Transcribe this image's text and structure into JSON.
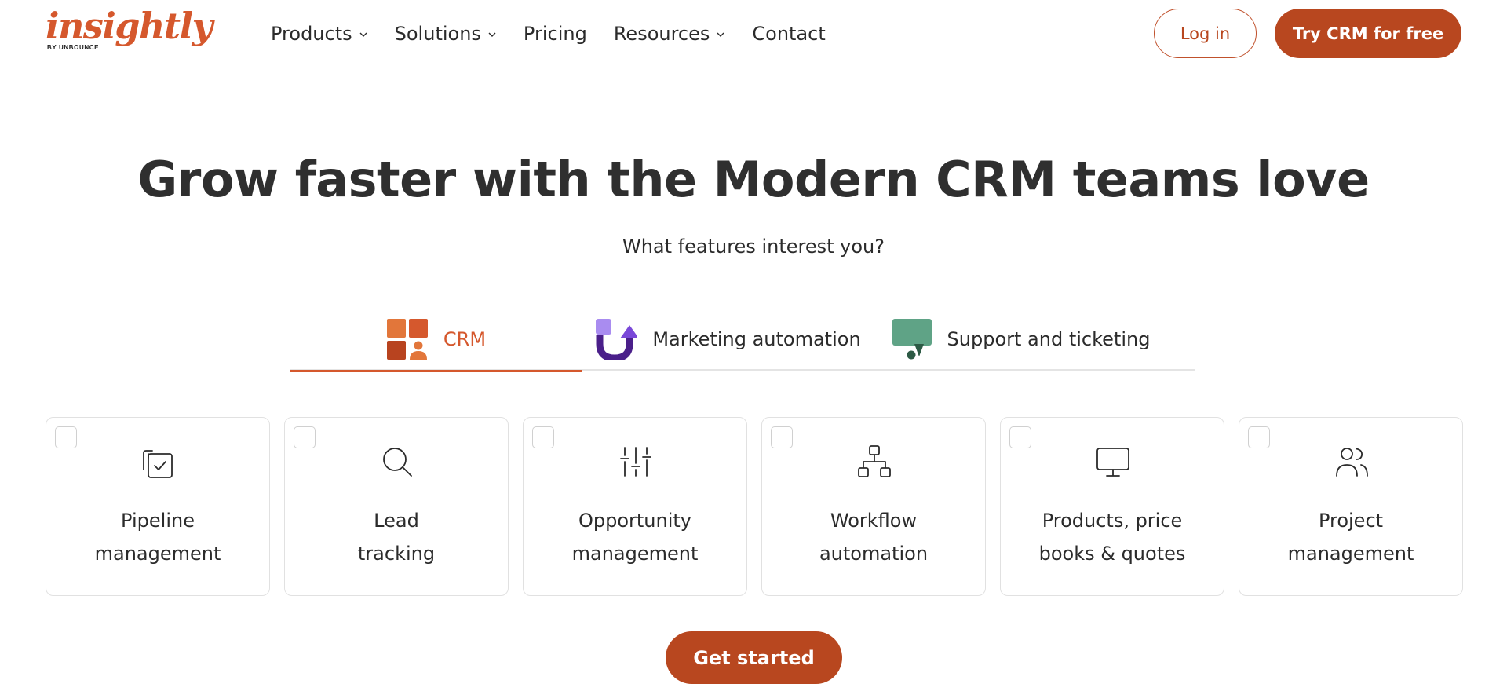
{
  "logo": {
    "name": "insightly",
    "byline": "BY UNBOUNCE"
  },
  "nav": {
    "items": [
      {
        "label": "Products",
        "has_dropdown": true
      },
      {
        "label": "Solutions",
        "has_dropdown": true
      },
      {
        "label": "Pricing",
        "has_dropdown": false
      },
      {
        "label": "Resources",
        "has_dropdown": true
      },
      {
        "label": "Contact",
        "has_dropdown": false
      }
    ],
    "login_label": "Log in",
    "trial_label": "Try CRM for free"
  },
  "hero": {
    "title": "Grow faster with the Modern CRM teams love",
    "subtitle": "What features interest you?"
  },
  "tabs": [
    {
      "label": "CRM",
      "icon": "crm-blocks-icon",
      "active": true
    },
    {
      "label": "Marketing automation",
      "icon": "marketing-arrow-icon",
      "active": false
    },
    {
      "label": "Support and ticketing",
      "icon": "support-chat-icon",
      "active": false
    }
  ],
  "features": [
    {
      "label": "Pipeline\nmanagement",
      "icon": "pipeline-checklist-icon",
      "checked": false
    },
    {
      "label": "Lead\ntracking",
      "icon": "search-icon",
      "checked": false
    },
    {
      "label": "Opportunity\nmanagement",
      "icon": "sliders-icon",
      "checked": false
    },
    {
      "label": "Workflow\nautomation",
      "icon": "hierarchy-icon",
      "checked": false
    },
    {
      "label": "Products, price\nbooks & quotes",
      "icon": "monitor-icon",
      "checked": false
    },
    {
      "label": "Project\nmanagement",
      "icon": "users-icon",
      "checked": false
    }
  ],
  "cta": {
    "label": "Get started"
  },
  "colors": {
    "brand": "#d5582d",
    "button": "#b8471f",
    "text": "#2b2b2b",
    "border": "#e1e1e1",
    "marketing_purple": "#5a2a9a",
    "support_green": "#5fa386"
  }
}
